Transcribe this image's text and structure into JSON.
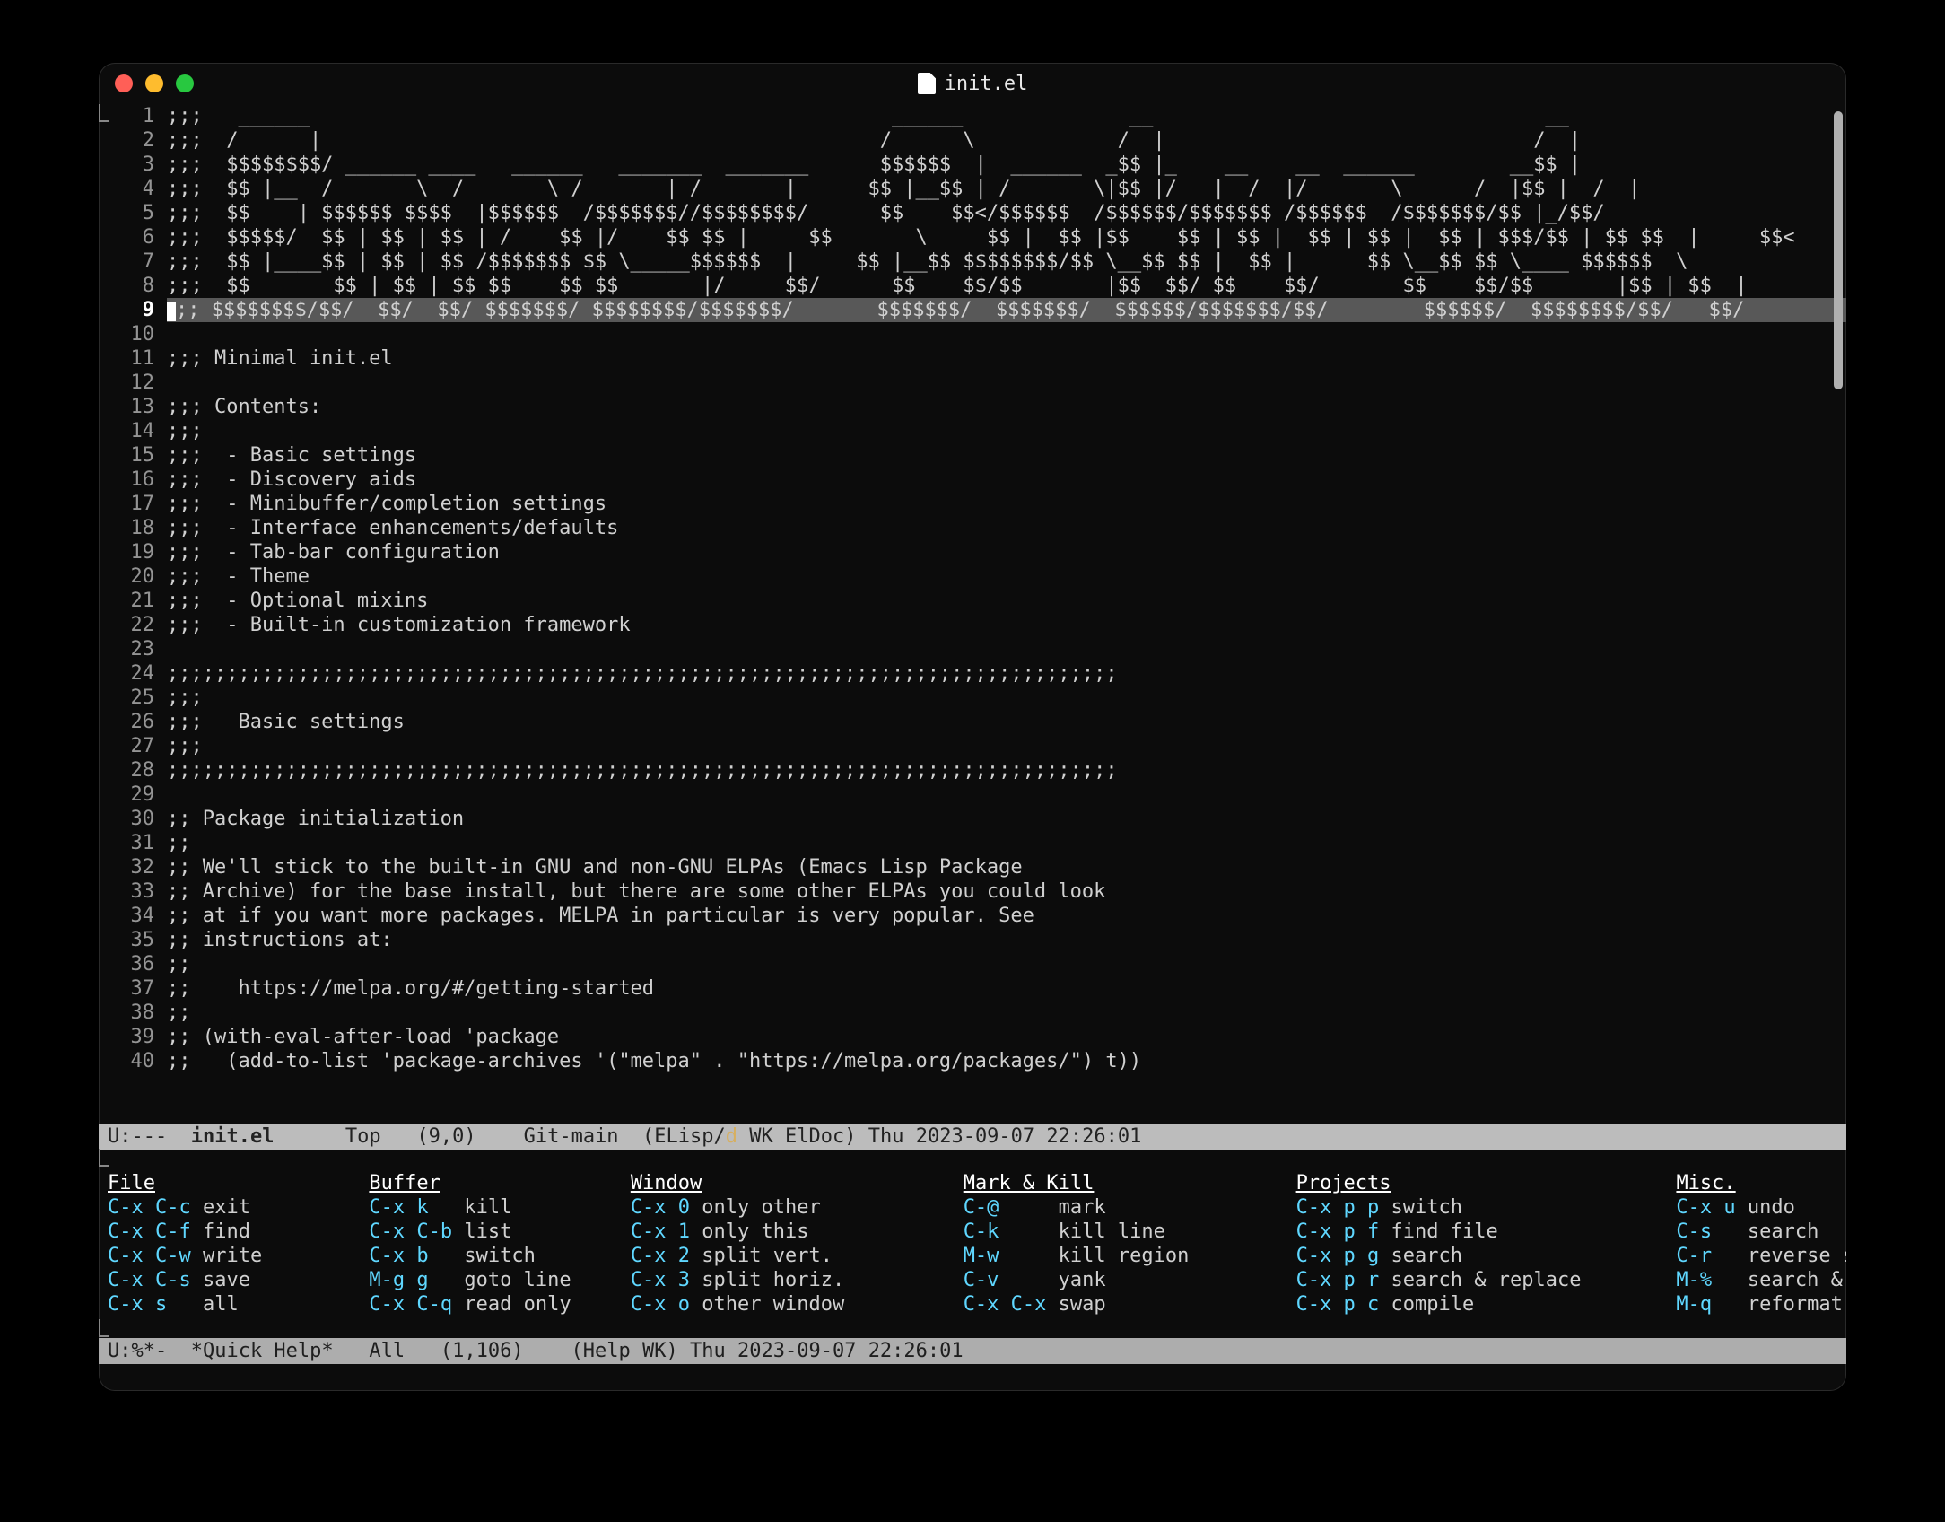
{
  "title": {
    "filename": "init.el"
  },
  "buffer": {
    "first_line": 1,
    "cursor_line": 9,
    "lines": [
      ";;;   ______                                                 ______              __                                 __",
      ";;;  /      |                                               /      \\            /  |                               /  |",
      ";;;  $$$$$$$$/ ______ ____   ______   _______  _______      $$$$$$  |  ______  _$$ |_    __    __  ______        __$$ |",
      ";;;  $$ |__  /       \\  /       \\ /       | /       |      $$ |__$$ | /       \\|$$ |/   |  /  |/       \\      /  |$$ |  /  |",
      ";;;  $$    | $$$$$$ $$$$  |$$$$$$  /$$$$$$$//$$$$$$$$/      $$    $$</$$$$$$  /$$$$$$/$$$$$$$ /$$$$$$  /$$$$$$$/$$ |_/$$/",
      ";;;  $$$$$/  $$ | $$ | $$ | /    $$ |/    $$ $$ |     $$       \\     $$ |  $$ |$$    $$ | $$ |  $$ | $$ |  $$ | $$$/$$ | $$ $$  |     $$<",
      ";;;  $$ |____$$ | $$ | $$ /$$$$$$$ $$ \\_____$$$$$$  |     $$ |__$$ $$$$$$$$/$$ \\__$$ $$ |  $$ |      $$ \\__$$ $$ \\____ $$$$$$  \\",
      ";;;  $$       $$ | $$ | $$ $$    $$ $$       |/     $$/      $$    $$/$$       |$$  $$/ $$    $$/       $$    $$/$$       |$$ | $$  |",
      ";;; $$$$$$$$/$$/  $$/  $$/ $$$$$$$/ $$$$$$$$/$$$$$$$/       $$$$$$$/  $$$$$$$/  $$$$$$/$$$$$$$/$$/        $$$$$$/  $$$$$$$$/$$/   $$/",
      "",
      ";;; Minimal init.el",
      "",
      ";;; Contents:",
      ";;;",
      ";;;  - Basic settings",
      ";;;  - Discovery aids",
      ";;;  - Minibuffer/completion settings",
      ";;;  - Interface enhancements/defaults",
      ";;;  - Tab-bar configuration",
      ";;;  - Theme",
      ";;;  - Optional mixins",
      ";;;  - Built-in customization framework",
      "",
      ";;;;;;;;;;;;;;;;;;;;;;;;;;;;;;;;;;;;;;;;;;;;;;;;;;;;;;;;;;;;;;;;;;;;;;;;;;;;;;;;",
      ";;;",
      ";;;   Basic settings",
      ";;;",
      ";;;;;;;;;;;;;;;;;;;;;;;;;;;;;;;;;;;;;;;;;;;;;;;;;;;;;;;;;;;;;;;;;;;;;;;;;;;;;;;;",
      "",
      ";; Package initialization",
      ";;",
      ";; We'll stick to the built-in GNU and non-GNU ELPAs (Emacs Lisp Package",
      ";; Archive) for the base install, but there are some other ELPAs you could look",
      ";; at if you want more packages. MELPA in particular is very popular. See",
      ";; instructions at:",
      ";;",
      ";;    https://melpa.org/#/getting-started",
      ";;",
      ";; (with-eval-after-load 'package",
      ";;   (add-to-list 'package-archives '(\"melpa\" . \"https://melpa.org/packages/\") t))"
    ]
  },
  "modeline_main": {
    "left": "U:---  ",
    "buffer": "init.el",
    "pos": "      Top   (9,0)    ",
    "vcs": "Git-main",
    "mode_open": "  (ELisp/",
    "mode_d": "d",
    "mode_rest": " WK ElDoc) ",
    "time": "Thu 2023-09-07 22:26:01"
  },
  "help": {
    "headers": [
      "File",
      "Buffer",
      "Window",
      "Mark & Kill",
      "Projects",
      "Misc."
    ],
    "rows": [
      [
        [
          "C-x C-c",
          "exit"
        ],
        [
          "C-x k  ",
          "kill"
        ],
        [
          "C-x 0",
          "only other"
        ],
        [
          "C-@    ",
          "mark"
        ],
        [
          "C-x p p",
          "switch"
        ],
        [
          "C-x u",
          "undo"
        ]
      ],
      [
        [
          "C-x C-f",
          "find"
        ],
        [
          "C-x C-b",
          "list"
        ],
        [
          "C-x 1",
          "only this"
        ],
        [
          "C-k    ",
          "kill line"
        ],
        [
          "C-x p f",
          "find file"
        ],
        [
          "C-s  ",
          "search"
        ]
      ],
      [
        [
          "C-x C-w",
          "write"
        ],
        [
          "C-x b  ",
          "switch"
        ],
        [
          "C-x 2",
          "split vert."
        ],
        [
          "M-w    ",
          "kill region"
        ],
        [
          "C-x p g",
          "search"
        ],
        [
          "C-r  ",
          "reverse search"
        ]
      ],
      [
        [
          "C-x C-s",
          "save"
        ],
        [
          "M-g g  ",
          "goto line"
        ],
        [
          "C-x 3",
          "split horiz."
        ],
        [
          "C-v    ",
          "yank"
        ],
        [
          "C-x p r",
          "search & replace"
        ],
        [
          "M-%  ",
          "search & replace"
        ]
      ],
      [
        [
          "C-x s  ",
          "all"
        ],
        [
          "C-x C-q",
          "read only"
        ],
        [
          "C-x o",
          "other window"
        ],
        [
          "C-x C-x",
          "swap"
        ],
        [
          "C-x p c",
          "compile"
        ],
        [
          "M-q  ",
          "reformat"
        ]
      ]
    ]
  },
  "modeline_help": {
    "text": "U:%*-  *Quick Help*   All   (1,106)    (Help WK) Thu 2023-09-07 22:26:01"
  },
  "echo": ""
}
